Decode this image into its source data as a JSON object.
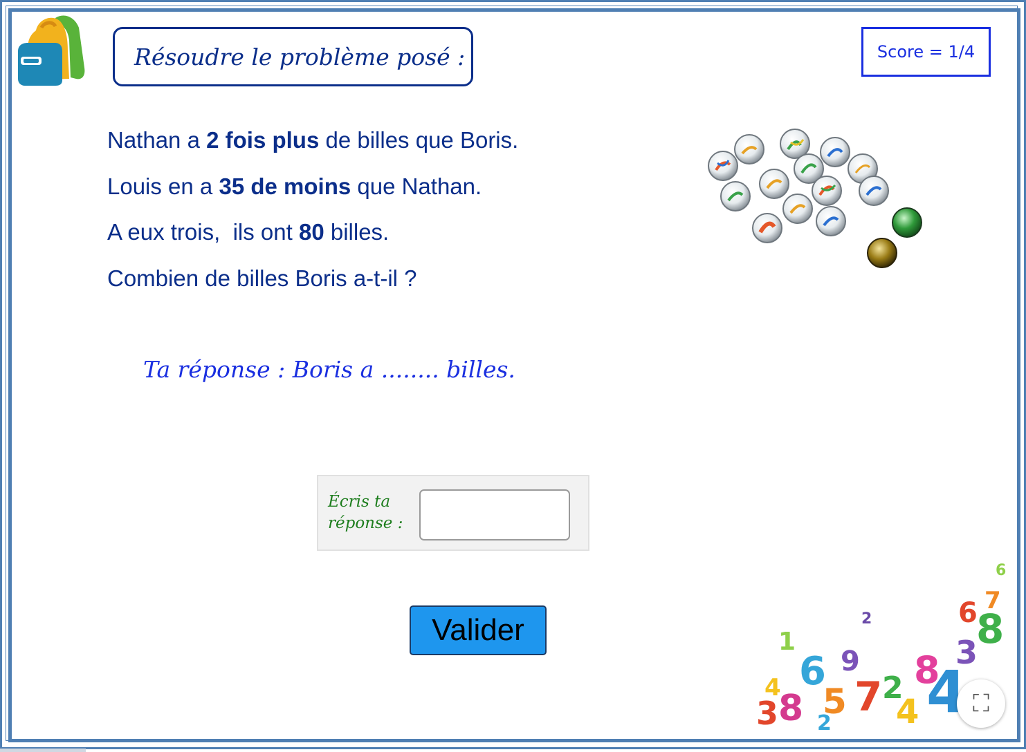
{
  "header": {
    "title": "Résoudre le problème posé :",
    "score": "Score = 1/4"
  },
  "problem": {
    "line1": {
      "pre": "Nathan a ",
      "bold": "2 fois plus",
      "post": " de billes que Boris."
    },
    "line2": {
      "pre": "Louis en a ",
      "bold": "35 de moins",
      "post": " que Nathan."
    },
    "line3": {
      "pre": "A eux trois,  ils ont ",
      "bold": "80",
      "post": " billes."
    },
    "line4": "Combien de billes Boris a-t-il ?"
  },
  "answer_hint": "Ta réponse : Boris a ........ billes.",
  "input": {
    "label_line1": "Écris ta",
    "label_line2": "réponse :",
    "value": ""
  },
  "buttons": {
    "validate_label": "Valider",
    "fullscreen_glyph": "⛶"
  },
  "icons": {
    "backpack": "backpack-icon",
    "marbles": "marbles-image",
    "numbers": "numbers-pile-image",
    "fullscreen": "fullscreen-icon"
  },
  "colors": {
    "frame": "#4f7fb3",
    "text_dark_blue": "#0b2e8a",
    "score_blue": "#1a2fe0",
    "label_green": "#1d7d1d",
    "button_blue": "#1e96ee"
  }
}
